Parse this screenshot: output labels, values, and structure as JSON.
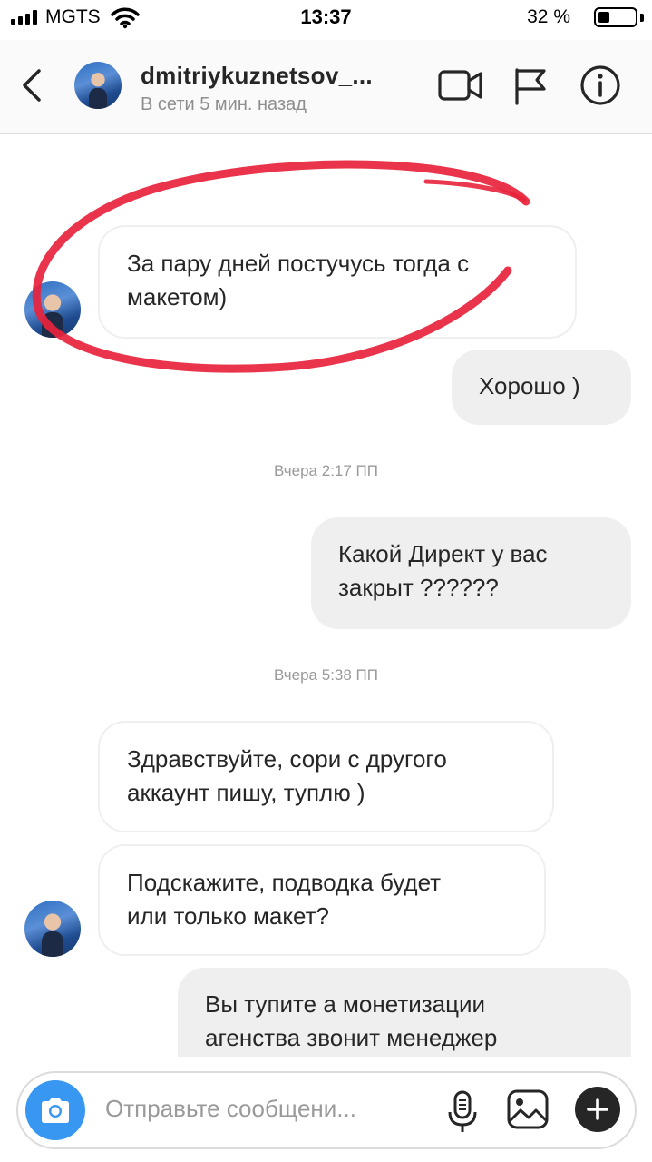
{
  "status_bar": {
    "carrier": "MGTS",
    "time": "13:37",
    "battery_text": "32 %",
    "battery_level": 0.32
  },
  "header": {
    "username": "dmitriykuznetsov_...",
    "status": "В сети 5 мин. назад",
    "icons": [
      "back-chevron-icon",
      "video-call-icon",
      "flag-icon",
      "info-icon"
    ]
  },
  "chat": {
    "timestamps": [
      "Вчера 2:17 ПП",
      "Вчера 5:38 ПП"
    ],
    "messages": [
      {
        "from": "them",
        "lines": [
          "За пару дней постучусь тогда с",
          "макетом)"
        ]
      },
      {
        "from": "me",
        "lines": [
          "Хорошо )"
        ]
      },
      {
        "from": "me",
        "lines": [
          "Какой Директ у вас",
          "закрыт ??????"
        ]
      },
      {
        "from": "them",
        "lines": [
          "Здравствуйте, сори с другого",
          "аккаунт пишу, туплю )"
        ]
      },
      {
        "from": "them",
        "lines": [
          "Подскажите, подводка будет",
          "или только макет?"
        ]
      },
      {
        "from": "me",
        "lines": [
          "Вы тупите а монетизации",
          "агенства звонит менеджер"
        ]
      }
    ],
    "annotation_color": "#e8233c"
  },
  "composer": {
    "placeholder": "Отправьте сообщени...",
    "icons": [
      "camera-icon",
      "microphone-icon",
      "gallery-icon",
      "plus-icon"
    ],
    "accent": "#3897f0"
  }
}
